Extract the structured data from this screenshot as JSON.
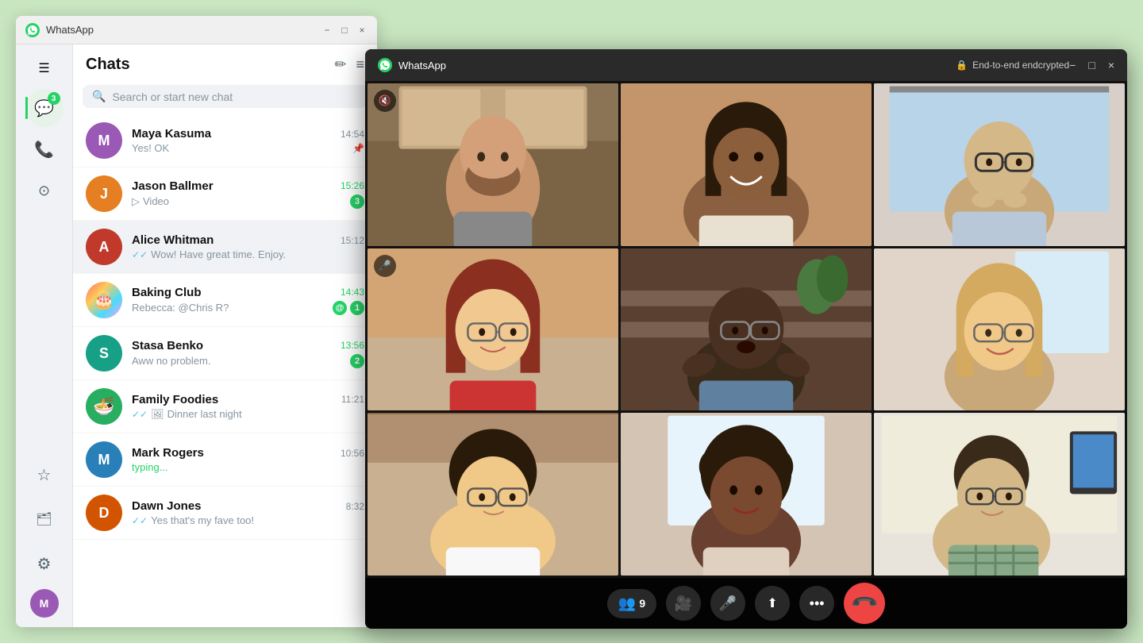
{
  "bg_window": {
    "title": "WhatsApp",
    "title_bar": {
      "minimize_label": "−",
      "maximize_label": "□",
      "close_label": "×"
    }
  },
  "sidebar": {
    "hamburger_icon": "☰",
    "chats_icon": "💬",
    "chats_badge": "3",
    "calls_icon": "📞",
    "status_icon": "⊙",
    "starred_icon": "☆",
    "archived_icon": "🗂",
    "settings_icon": "⚙"
  },
  "chat_panel": {
    "title": "Chats",
    "new_chat_icon": "✏",
    "filter_icon": "≡",
    "search_placeholder": "Search or start new chat"
  },
  "chat_list": [
    {
      "id": "maya",
      "name": "Maya Kasuma",
      "preview": "Yes! OK",
      "time": "14:54",
      "time_green": false,
      "unread": 0,
      "pinned": true,
      "double_check": false
    },
    {
      "id": "jason",
      "name": "Jason Ballmer",
      "preview": "Video",
      "preview_icon": "▷",
      "time": "15:26",
      "time_green": true,
      "unread": 3,
      "pinned": false,
      "double_check": false
    },
    {
      "id": "alice",
      "name": "Alice Whitman",
      "preview": "Wow! Have great time. Enjoy.",
      "time": "15:12",
      "time_green": false,
      "unread": 0,
      "pinned": false,
      "double_check": true,
      "active": true
    },
    {
      "id": "baking",
      "name": "Baking Club",
      "preview": "Rebecca: @Chris R?",
      "time": "14:43",
      "time_green": true,
      "unread": 1,
      "mention": true,
      "pinned": false,
      "double_check": false
    },
    {
      "id": "stasa",
      "name": "Stasa Benko",
      "preview": "Aww no problem.",
      "time": "13:56",
      "time_green": true,
      "unread": 2,
      "pinned": false,
      "double_check": false
    },
    {
      "id": "family",
      "name": "Family Foodies",
      "preview": "Dinner last night",
      "preview_icon": "🖼",
      "time": "11:21",
      "time_green": false,
      "unread": 0,
      "pinned": false,
      "double_check": true
    },
    {
      "id": "mark",
      "name": "Mark Rogers",
      "preview": "typing...",
      "preview_typing": true,
      "time": "10:56",
      "time_green": false,
      "unread": 0,
      "pinned": false,
      "double_check": false
    },
    {
      "id": "dawn",
      "name": "Dawn Jones",
      "preview": "Yes that's my fave too!",
      "time": "8:32",
      "time_green": false,
      "unread": 0,
      "pinned": false,
      "double_check": true
    }
  ],
  "video_window": {
    "title": "WhatsApp",
    "encryption_label": "End-to-end endcrypted",
    "title_bar": {
      "minimize_label": "−",
      "maximize_label": "□",
      "close_label": "×"
    },
    "participants_count": "9",
    "controls": {
      "participants_label": "9",
      "camera_icon": "📹",
      "mic_icon": "🎤",
      "screen_icon": "⬆",
      "more_icon": "•••",
      "end_call_icon": "📞"
    }
  }
}
